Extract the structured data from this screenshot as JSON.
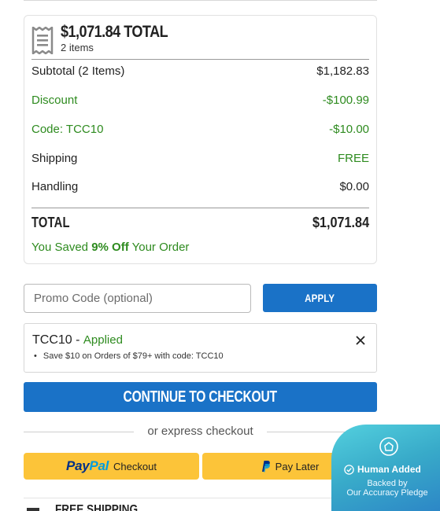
{
  "summary": {
    "total_heading": "$1,071.84 TOTAL",
    "items_count": "2 items",
    "rows": [
      {
        "label": "Subtotal (2 Items)",
        "value": "$1,182.83"
      },
      {
        "label": "Discount",
        "value": "-$100.99"
      },
      {
        "label": "Code: TCC10",
        "value": "-$10.00"
      },
      {
        "label": "Shipping",
        "value": "FREE"
      },
      {
        "label": "Handling",
        "value": "$0.00"
      }
    ],
    "grand_total": {
      "label": "TOTAL",
      "value": "$1,071.84"
    },
    "saved": {
      "prefix": "You Saved ",
      "amount": "9% Off",
      "suffix": " Your Order"
    }
  },
  "promo": {
    "placeholder": "Promo Code (optional)",
    "apply_label": "APPLY",
    "applied_code": "TCC10",
    "applied_separator": " - ",
    "applied_status": "Applied",
    "applied_detail": "Save $10 on Orders of $79+ with code: TCC10"
  },
  "checkout": {
    "continue_label": "CONTINUE TO CHECKOUT",
    "express_label": "or express checkout",
    "paypal_logo_pay": "Pay",
    "paypal_logo_pal": "Pal",
    "paypal_label": "Checkout",
    "paylater_label": "Pay Later"
  },
  "next_section": {
    "heading": "FREE SHIPPING"
  },
  "pledge_badge": {
    "title": "Human Added",
    "line1": "Backed by",
    "line2": "Our Accuracy Pledge"
  },
  "colors": {
    "accent_blue": "#1a72c7",
    "savings_green": "#2e8b1f",
    "paypal_yellow": "#fcc439"
  },
  "icons": [
    "receipt-icon",
    "close-icon",
    "paypal-icon",
    "shield-icon",
    "check-circle-icon"
  ]
}
